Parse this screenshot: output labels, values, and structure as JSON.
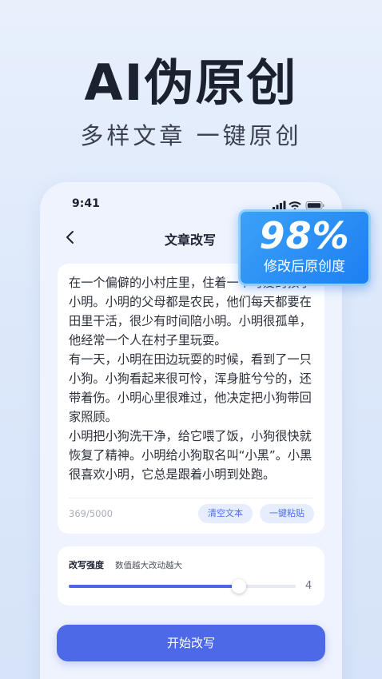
{
  "hero": {
    "title": "AI伪原创",
    "subtitle": "多样文章 一键原创"
  },
  "status_bar": {
    "time": "9:41",
    "icons": [
      "signal-icon",
      "wifi-icon",
      "battery-icon"
    ]
  },
  "nav": {
    "back_icon": "chevron-left-icon",
    "title": "文章改写"
  },
  "badge": {
    "value": "98%",
    "label": "修改后原创度"
  },
  "article": {
    "text": "在一个偏僻的小村庄里，住着一个可爱的孩子小明。小明的父母都是农民，他们每天都要在田里干活，很少有时间陪小明。小明很孤单，他经常一个人在村子里玩耍。\n有一天，小明在田边玩耍的时候，看到了一只小狗。小狗看起来很可怜，浑身脏兮兮的，还带着伤。小明心里很难过，他决定把小狗带回家照顾。\n小明把小狗洗干净，给它喂了饭，小狗很快就恢复了精神。小明给小狗取名叫“小黑”。小黑很喜欢小明，它总是跟着小明到处跑。",
    "char_count": "369/5000",
    "clear_label": "清空文本",
    "paste_label": "一键粘贴"
  },
  "strength": {
    "label": "改写强度",
    "hint": "数值越大改动越大",
    "value": "4",
    "level_fraction": 0.75
  },
  "start_button": {
    "label": "开始改写"
  },
  "colors": {
    "accent": "#4d69e8",
    "badge": "#1d7ff2",
    "background": "#e3ecfb"
  }
}
